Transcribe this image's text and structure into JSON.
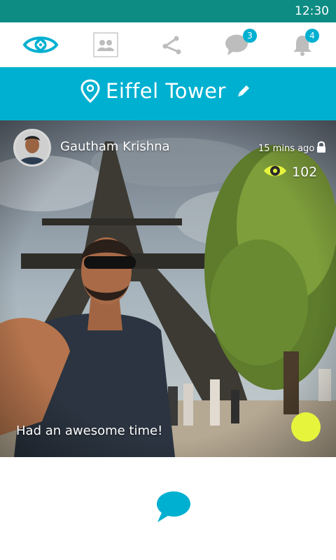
{
  "status_bar": {
    "time": "12:30"
  },
  "nav": {
    "items": [
      {
        "name": "eye-logo",
        "icon": "eye-icon",
        "active": true
      },
      {
        "name": "contacts",
        "icon": "contacts-icon"
      },
      {
        "name": "share",
        "icon": "share-icon"
      },
      {
        "name": "messages",
        "icon": "chat-icon",
        "badge": "3"
      },
      {
        "name": "notifications",
        "icon": "bell-icon",
        "badge": "4"
      }
    ]
  },
  "location": {
    "title": "Eiffel Tower",
    "icon": "map-pin-icon",
    "edit_icon": "pencil-icon"
  },
  "post": {
    "user_name": "Gautham Krishna",
    "time_ago": "15 mins ago",
    "privacy_icon": "lock-icon",
    "views_icon": "eye-icon",
    "view_count": "102",
    "caption": "Had an awesome time!",
    "status_color": "#e6f53c"
  },
  "footer": {
    "comment_icon": "comment-bubble-icon"
  },
  "colors": {
    "status_bar": "#0c8c83",
    "accent": "#00b0d0",
    "badge": "#00b0d0",
    "eye_yellow": "#e6f53c",
    "icon_gray": "#bdbdbd"
  }
}
